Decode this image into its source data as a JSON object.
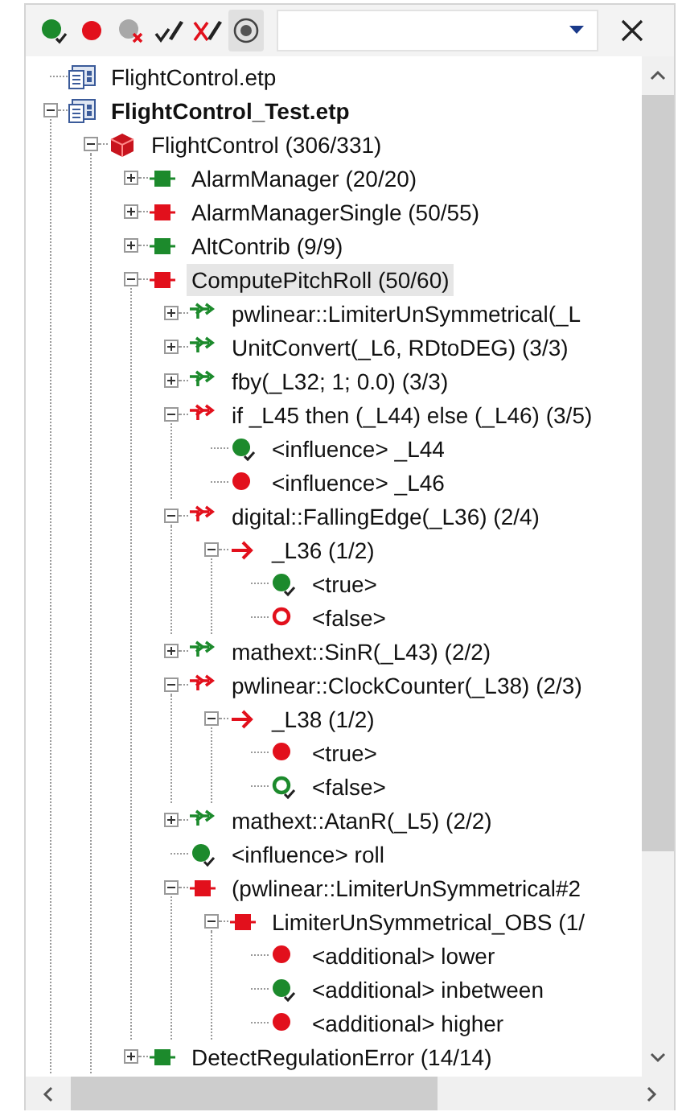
{
  "toolbar": {
    "tools": [
      {
        "kind": "covered",
        "pressed": false
      },
      {
        "kind": "uncovered",
        "pressed": false
      },
      {
        "kind": "clear",
        "pressed": false
      },
      {
        "kind": "justify",
        "pressed": false
      },
      {
        "kind": "unjustify",
        "pressed": false
      },
      {
        "kind": "target",
        "pressed": true
      }
    ]
  },
  "tree": {
    "items": [
      {
        "label": "FlightControl.etp",
        "kind": "project",
        "active": false,
        "selected": false
      },
      {
        "label": "FlightControl_Test.etp",
        "kind": "project",
        "active": true,
        "selected": false,
        "expanded": true,
        "children": [
          {
            "label": "FlightControl (306/331)",
            "kind": "package",
            "selected": false,
            "expanded": true,
            "children": [
              {
                "label": "AlarmManager (20/20)",
                "kind": "block",
                "color": "#1c8a2c",
                "selected": false,
                "expanded": false
              },
              {
                "label": "AlarmManagerSingle (50/55)",
                "kind": "block",
                "color": "#e2101c",
                "selected": false,
                "expanded": false
              },
              {
                "label": "AltContrib (9/9)",
                "kind": "block",
                "color": "#1c8a2c",
                "selected": false,
                "expanded": false
              },
              {
                "label": "ComputePitchRoll (50/60)",
                "kind": "block",
                "color": "#e2101c",
                "selected": true,
                "expanded": true,
                "children": [
                  {
                    "label": "pwlinear::LimiterUnSymmetrical(_L",
                    "kind": "operator",
                    "color": "#1c8a2c",
                    "selected": false,
                    "expanded": false
                  },
                  {
                    "label": "UnitConvert(_L6, RDtoDEG) (3/3)",
                    "kind": "operator",
                    "color": "#1c8a2c",
                    "selected": false,
                    "expanded": false
                  },
                  {
                    "label": "fby(_L32; 1; 0.0) (3/3)",
                    "kind": "operator",
                    "color": "#1c8a2c",
                    "selected": false,
                    "expanded": false
                  },
                  {
                    "label": "if _L45 then (_L44) else (_L46) (3/5)",
                    "kind": "operator",
                    "color": "#e2101c",
                    "selected": false,
                    "expanded": true,
                    "children": [
                      {
                        "label": "<influence> _L44",
                        "kind": "result",
                        "color": "#1c8a2c",
                        "filled": true,
                        "checked": true,
                        "selected": false
                      },
                      {
                        "label": "<influence> _L46",
                        "kind": "result",
                        "color": "#e2101c",
                        "filled": true,
                        "checked": false,
                        "selected": false
                      }
                    ]
                  },
                  {
                    "label": "digital::FallingEdge(_L36) (2/4)",
                    "kind": "operator",
                    "color": "#e2101c",
                    "selected": false,
                    "expanded": true,
                    "children": [
                      {
                        "label": "_L36 (1/2)",
                        "kind": "branch",
                        "color": "#e2101c",
                        "selected": false,
                        "expanded": true,
                        "children": [
                          {
                            "label": "<true>",
                            "kind": "result",
                            "color": "#1c8a2c",
                            "filled": true,
                            "checked": true,
                            "selected": false
                          },
                          {
                            "label": "<false>",
                            "kind": "result",
                            "color": "#e2101c",
                            "filled": false,
                            "checked": false,
                            "selected": false
                          }
                        ]
                      }
                    ]
                  },
                  {
                    "label": "mathext::SinR(_L43) (2/2)",
                    "kind": "operator",
                    "color": "#1c8a2c",
                    "selected": false,
                    "expanded": false
                  },
                  {
                    "label": "pwlinear::ClockCounter(_L38) (2/3)",
                    "kind": "operator",
                    "color": "#e2101c",
                    "selected": false,
                    "expanded": true,
                    "children": [
                      {
                        "label": "_L38 (1/2)",
                        "kind": "branch",
                        "color": "#e2101c",
                        "selected": false,
                        "expanded": true,
                        "children": [
                          {
                            "label": "<true>",
                            "kind": "result",
                            "color": "#e2101c",
                            "filled": true,
                            "checked": false,
                            "selected": false
                          },
                          {
                            "label": "<false>",
                            "kind": "result",
                            "color": "#1c8a2c",
                            "filled": false,
                            "checked": true,
                            "selected": false
                          }
                        ]
                      }
                    ]
                  },
                  {
                    "label": "mathext::AtanR(_L5) (2/2)",
                    "kind": "operator",
                    "color": "#1c8a2c",
                    "selected": false,
                    "expanded": false
                  },
                  {
                    "label": "<influence> roll",
                    "kind": "result",
                    "color": "#1c8a2c",
                    "filled": true,
                    "checked": true,
                    "selected": false
                  },
                  {
                    "label": "(pwlinear::LimiterUnSymmetrical#2",
                    "kind": "block",
                    "color": "#e2101c",
                    "selected": false,
                    "expanded": true,
                    "children": [
                      {
                        "label": "LimiterUnSymmetrical_OBS (1/",
                        "kind": "block",
                        "color": "#e2101c",
                        "selected": false,
                        "expanded": true,
                        "children": [
                          {
                            "label": "<additional> lower",
                            "kind": "result",
                            "color": "#e2101c",
                            "filled": true,
                            "checked": false,
                            "selected": false
                          },
                          {
                            "label": "<additional> inbetween",
                            "kind": "result",
                            "color": "#1c8a2c",
                            "filled": true,
                            "checked": true,
                            "selected": false
                          },
                          {
                            "label": "<additional> higher",
                            "kind": "result",
                            "color": "#e2101c",
                            "filled": true,
                            "checked": false,
                            "selected": false
                          }
                        ]
                      }
                    ]
                  }
                ]
              },
              {
                "label": "DetectRegulationError (14/14)",
                "kind": "block",
                "color": "#1c8a2c",
                "selected": false,
                "expanded": false
              }
            ]
          }
        ]
      }
    ]
  }
}
